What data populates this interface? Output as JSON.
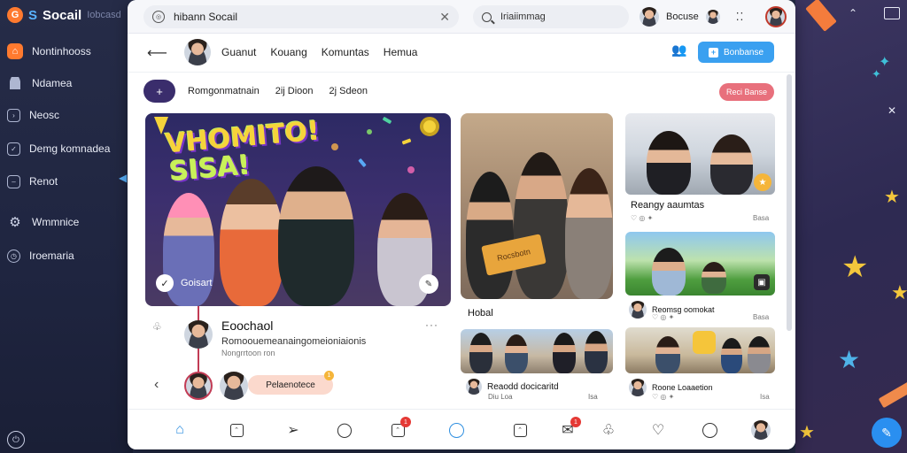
{
  "brand": {
    "badge": "G",
    "mark": "S",
    "name": "Socail",
    "tag": "Iobcasd"
  },
  "sidebar": {
    "items": [
      {
        "label": "Nontinhooss",
        "icon": "home-icon"
      },
      {
        "label": "Ndamea",
        "icon": "user-icon"
      },
      {
        "label": "Neosc",
        "icon": "square-icon"
      },
      {
        "label": "Demg komnadea",
        "icon": "checkbox-icon"
      },
      {
        "label": "Renot",
        "icon": "window-icon"
      },
      {
        "label": "Wmmnice",
        "icon": "gear-icon"
      },
      {
        "label": "Iroemaria",
        "icon": "clock-icon"
      }
    ]
  },
  "topbar": {
    "url": "hibann Socail",
    "search_value": "Iriaiimmag",
    "account_name": "Bocuse"
  },
  "header": {
    "tabs": [
      "Guanut",
      "Kouang",
      "Komuntas",
      "Hemua"
    ],
    "join_label": "Bonbanse"
  },
  "filters": {
    "pill_symbol": "+",
    "labels": [
      "Romgonmatnain",
      "2ij Dioon",
      "2j Sdeon"
    ],
    "save_label": "Reci Banse"
  },
  "feature": {
    "title_line1": "VHOMITO!",
    "title_line2": "SISA!",
    "tag_label": "Goisart"
  },
  "post": {
    "title": "Eoochaol",
    "body": "Romoouemeanaingomeioniaionis",
    "sub": "Nongrrtoon ron",
    "comment_label": "Pelaenotece",
    "comment_count": "1"
  },
  "middle": {
    "box_label": "Rocsbotn",
    "label": "Hobal",
    "sub_name": "Reaodd docicaritd",
    "sub_meta": "Diu Loa",
    "sub_right": "Isa"
  },
  "right": {
    "card1": {
      "title": "Reangy aaumtas",
      "meta": "Basa"
    },
    "card2": {
      "name": "Reomsg oomokat",
      "meta": "Basa"
    },
    "card3": {
      "name": "Roone Loaaetion",
      "meta": "Isa"
    }
  },
  "bottom_nav": {
    "badge_one": "1",
    "badge_two": "1"
  },
  "colors": {
    "accent": "#3aa0f0",
    "brand_orange": "#ff7a2f",
    "filter_pill": "#3a2d6c",
    "save_pill": "#e8707c"
  }
}
